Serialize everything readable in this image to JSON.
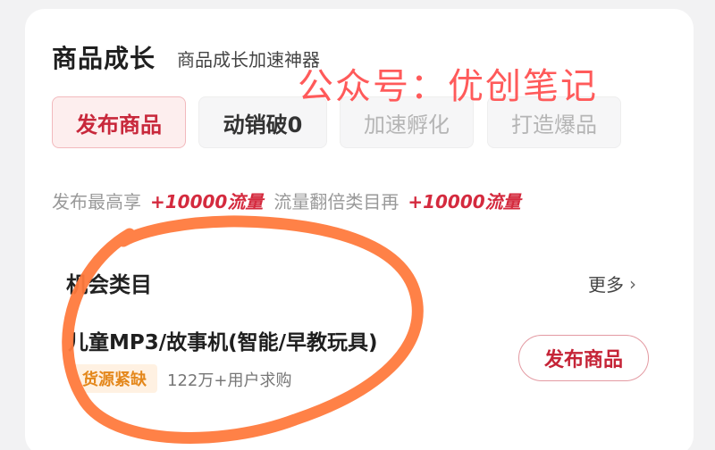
{
  "header": {
    "title": "商品成长",
    "subtitle": "商品成长加速神器"
  },
  "watermark": "公众号：优创笔记",
  "tabs": [
    {
      "label": "发布商品",
      "active": true
    },
    {
      "label": "动销破0",
      "active": false
    },
    {
      "label": "加速孵化",
      "active": false
    },
    {
      "label": "打造爆品",
      "active": false
    }
  ],
  "promo": {
    "text1": "发布最高享",
    "highlight1": "+10000流量",
    "text2": "流量翻倍类目再",
    "highlight2": "+10000流量"
  },
  "opportunity": {
    "section_title": "机会类目",
    "more_label": "更多",
    "item": {
      "name": "儿童MP3/故事机(智能/早教玩具)",
      "badge": "货源紧缺",
      "demand": "122万+用户求购",
      "button_label": "发布商品"
    }
  },
  "colors": {
    "accent": "#c8283b",
    "badge_text": "#e4871b",
    "scribble": "#ff7a3d"
  }
}
